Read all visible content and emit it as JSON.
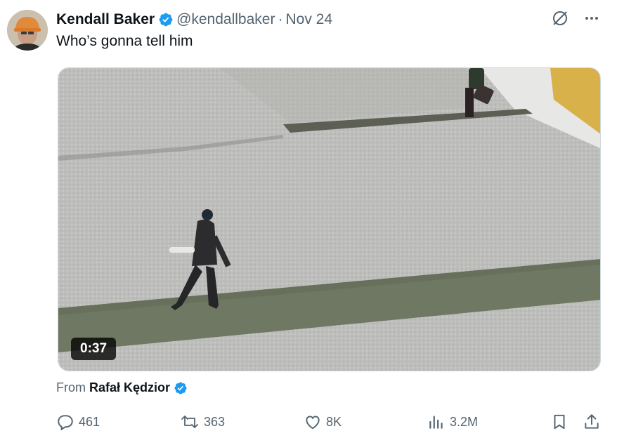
{
  "tweet": {
    "author_name": "Kendall Baker",
    "author_handle": "@kendallbaker",
    "separator": "·",
    "date": "Nov 24",
    "text": "Who’s gonna tell him"
  },
  "media": {
    "duration": "0:37"
  },
  "source": {
    "prefix": "From",
    "name": "Rafał Kędzior"
  },
  "metrics": {
    "replies": "461",
    "reposts": "363",
    "likes": "8K",
    "views": "3.2M"
  },
  "colors": {
    "verified_blue": "#1d9bf0",
    "text_primary": "#0f1419",
    "text_secondary": "#536471"
  },
  "icons": [
    "verified-badge-icon",
    "grok-icon",
    "more-icon",
    "reply-icon",
    "repost-icon",
    "like-icon",
    "views-icon",
    "bookmark-icon",
    "share-icon"
  ]
}
